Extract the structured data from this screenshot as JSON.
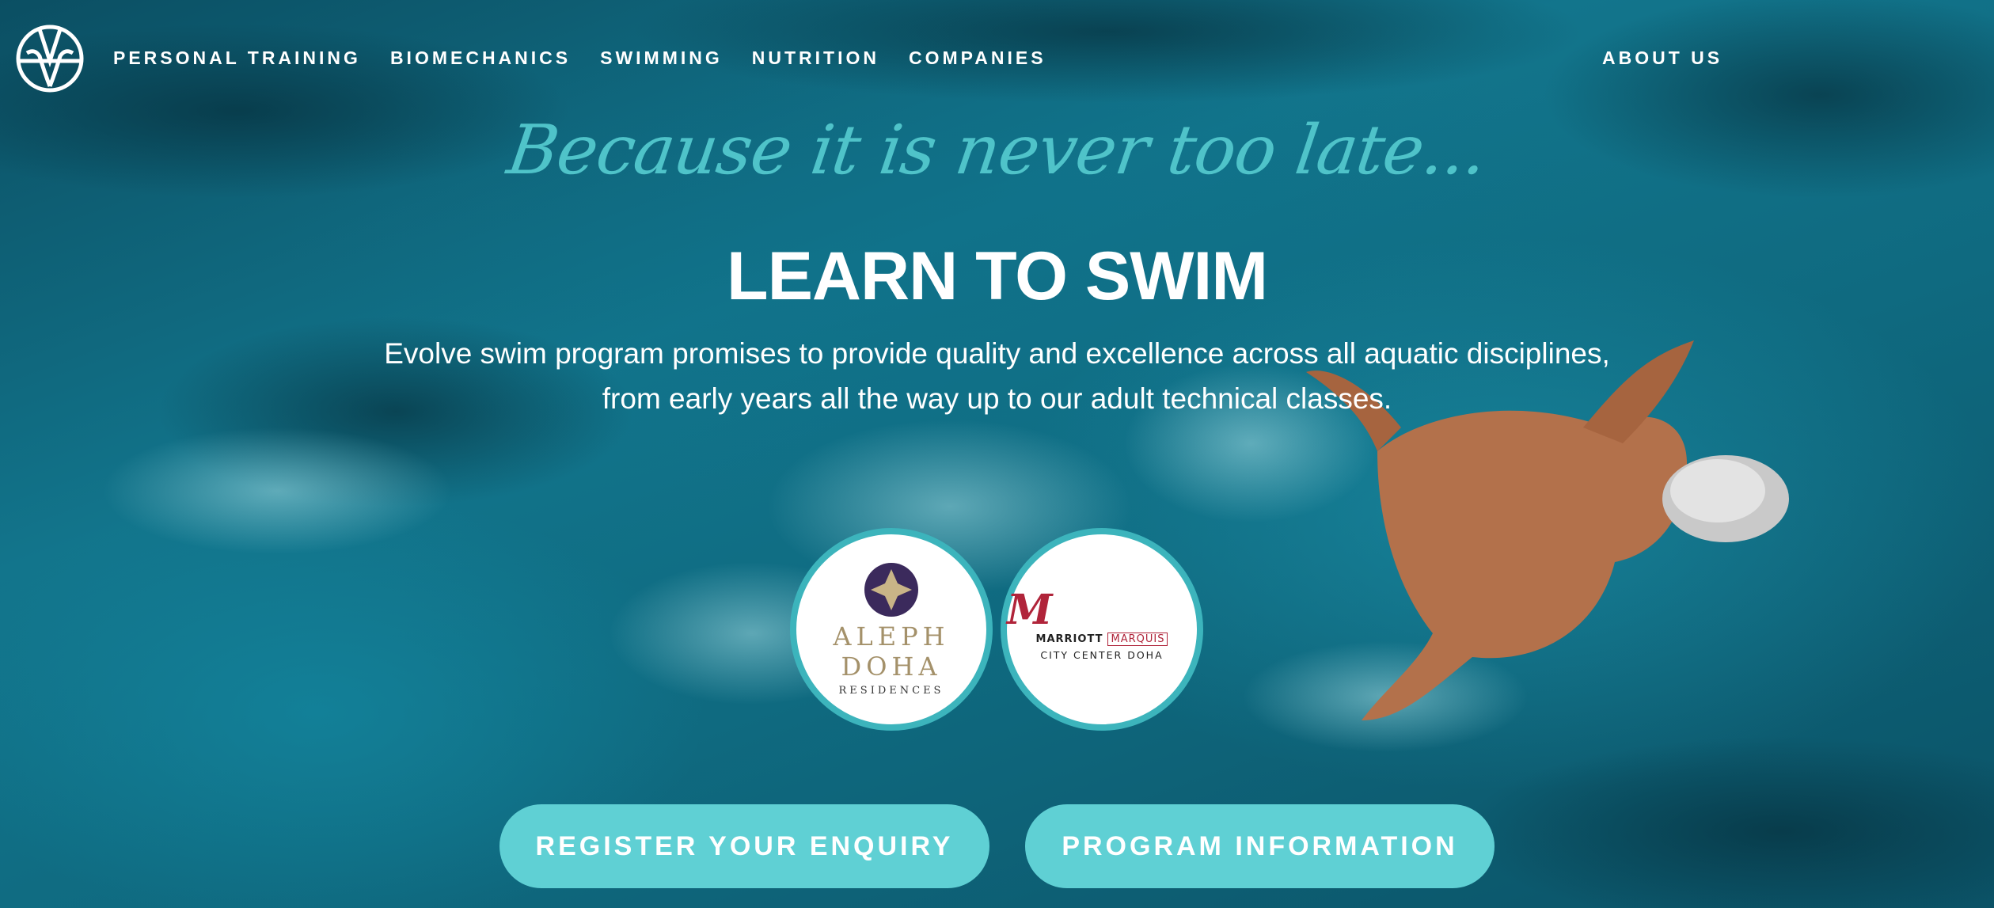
{
  "nav": {
    "items": [
      {
        "label": "PERSONAL TRAINING"
      },
      {
        "label": "BIOMECHANICS"
      },
      {
        "label": "SWIMMING"
      },
      {
        "label": "NUTRITION"
      },
      {
        "label": "COMPANIES"
      }
    ],
    "about": "ABOUT US",
    "logo_icon": "evolve-logo-icon"
  },
  "hero": {
    "tagline": "Because it is never too late...",
    "headline": "LEARN TO SWIM",
    "description_line1": "Evolve swim program promises to provide quality and excellence across all aquatic disciplines,",
    "description_line2": "from early years all the way up to our adult technical classes."
  },
  "partners": {
    "aleph": {
      "name_line1": "ALEPH",
      "name_line2": "DOHA",
      "sub": "RESIDENCES"
    },
    "marriott": {
      "mark": "M",
      "word": "MARRIOTT",
      "boxed": "MARQUIS",
      "city": "CITY CENTER DOHA"
    }
  },
  "cta": {
    "register": "REGISTER YOUR ENQUIRY",
    "program": "PROGRAM INFORMATION"
  },
  "colors": {
    "accent": "#5fd0d4",
    "tagline": "#4fc3c9",
    "ring": "#3cb4bc",
    "marriott_red": "#b0243a",
    "aleph_gold": "#a4916a",
    "aleph_purple": "#3b2a5c"
  }
}
